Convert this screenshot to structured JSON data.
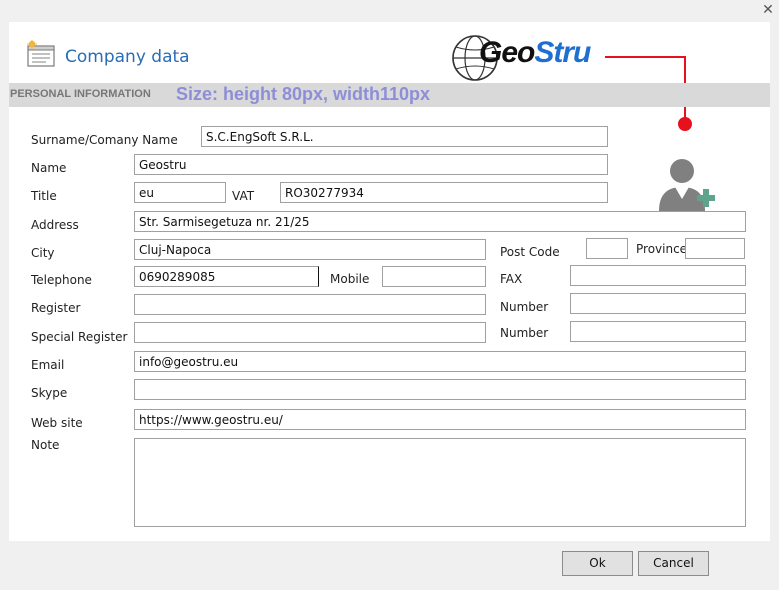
{
  "window": {
    "close_glyph": "✕"
  },
  "header": {
    "title": "Company data",
    "logo_part1": "Geo",
    "logo_part2": "Stru",
    "accent_color": "#2a6db5",
    "annotation_color": "#e8101d"
  },
  "section": {
    "label": "PERSONAL INFORMATION",
    "size_note": "Size: height 80px, width110px"
  },
  "form": {
    "surname_label": "Surname/Comany Name",
    "surname_value": "S.C.EngSoft S.R.L.",
    "name_label": "Name",
    "name_value": "Geostru",
    "title_label": "Title",
    "title_value": "eu",
    "vat_label": "VAT",
    "vat_value": "RO30277934",
    "address_label": "Address",
    "address_value": "Str. Sarmisegetuza nr. 21/25",
    "city_label": "City",
    "city_value": "Cluj-Napoca",
    "postcode_label": "Post Code",
    "postcode_value": "",
    "province_label": "Province",
    "province_value": "",
    "telephone_label": "Telephone",
    "telephone_value": "0690289085",
    "mobile_label": "Mobile",
    "mobile_value": "",
    "fax_label": "FAX",
    "fax_value": "",
    "register_label": "Register",
    "register_value": "",
    "number_label": "Number",
    "number_value": "",
    "special_register_label": "Special Register",
    "special_register_value": "",
    "number2_label": "Number",
    "number2_value": "",
    "email_label": "Email",
    "email_value": "info@geostru.eu",
    "skype_label": "Skype",
    "skype_value": "",
    "website_label": "Web site",
    "website_value": "https://www.geostru.eu/",
    "note_label": "Note",
    "note_value": ""
  },
  "avatar": {
    "icon": "add-user-icon"
  },
  "buttons": {
    "ok": "Ok",
    "cancel": "Cancel"
  }
}
